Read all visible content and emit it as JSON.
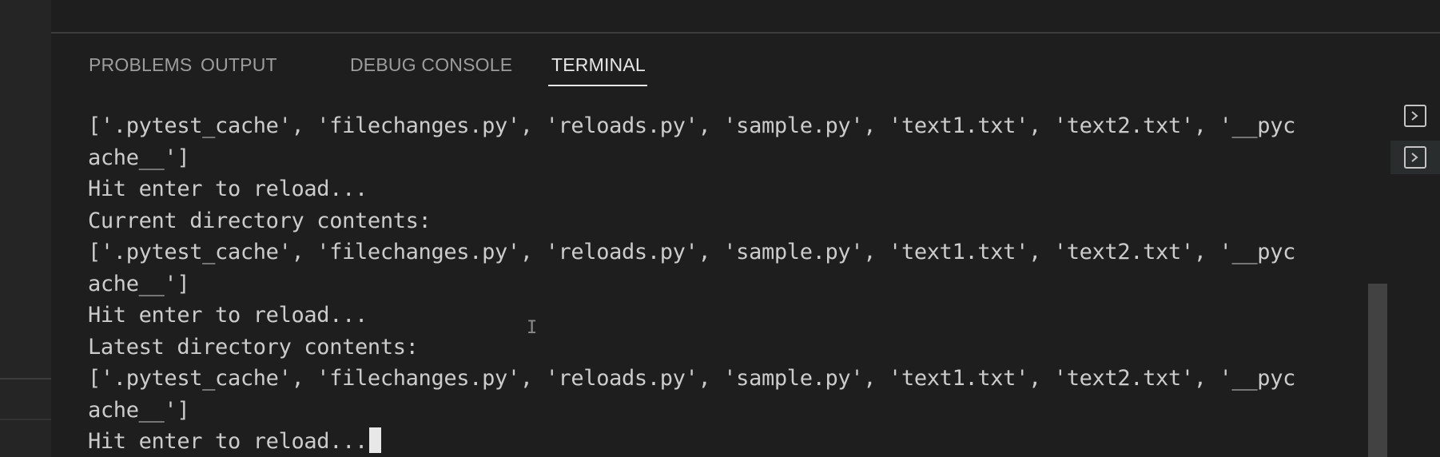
{
  "panel": {
    "tabs": [
      {
        "label": "PROBLEMS"
      },
      {
        "label": "OUTPUT"
      },
      {
        "label": "DEBUG CONSOLE"
      },
      {
        "label": "TERMINAL"
      }
    ],
    "active_tab": "TERMINAL"
  },
  "terminal": {
    "lines": [
      "['.pytest_cache', 'filechanges.py', 'reloads.py', 'sample.py', 'text1.txt', 'text2.txt', '__pyc",
      "ache__']",
      "Hit enter to reload...",
      "Current directory contents:",
      "['.pytest_cache', 'filechanges.py', 'reloads.py', 'sample.py', 'text1.txt', 'text2.txt', '__pyc",
      "ache__']",
      "Hit enter to reload...",
      "Latest directory contents:",
      "['.pytest_cache', 'filechanges.py', 'reloads.py', 'sample.py', 'text1.txt', 'text2.txt', '__pyc",
      "ache__']",
      "Hit enter to reload..."
    ]
  },
  "side_terminals": {
    "icon": "terminal-icon",
    "items": [
      {
        "icon": "terminal-icon"
      },
      {
        "icon": "terminal-icon"
      }
    ]
  },
  "colors": {
    "background": "#1e1e1e",
    "text": "#cccccc",
    "tab_inactive": "#9d9d9d",
    "tab_active": "#e7e7e7"
  }
}
